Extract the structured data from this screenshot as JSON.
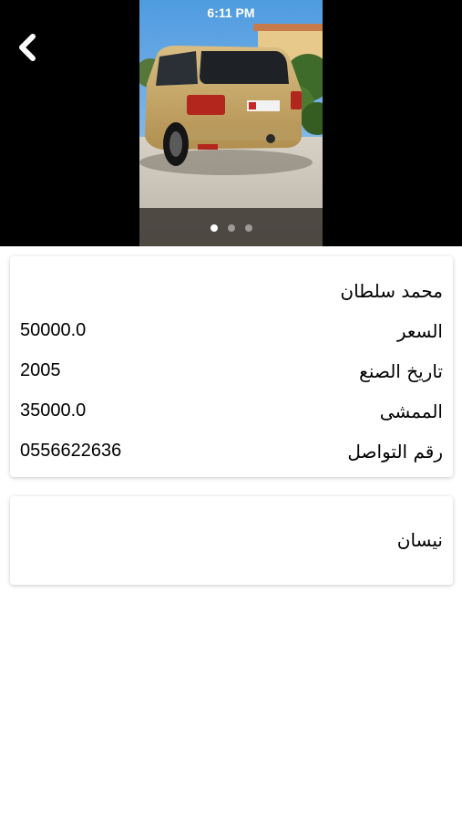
{
  "status_bar": {
    "time": "6:11 PM"
  },
  "header": {
    "back_icon": "chevron-left-icon"
  },
  "gallery": {
    "dot_count": 3,
    "active_index": 0
  },
  "details": {
    "owner_name": "محمد سلطان",
    "rows": [
      {
        "label": "السعر",
        "value": "50000.0"
      },
      {
        "label": "تاريخ الصنع",
        "value": "2005"
      },
      {
        "label": "الممشى",
        "value": "35000.0"
      },
      {
        "label": "رقم التواصل",
        "value": "0556622636"
      }
    ]
  },
  "brand": {
    "name": "نيسان"
  },
  "colors": {
    "hero_background": "#000000",
    "card_background": "#ffffff",
    "car_body": "#c9a866"
  }
}
